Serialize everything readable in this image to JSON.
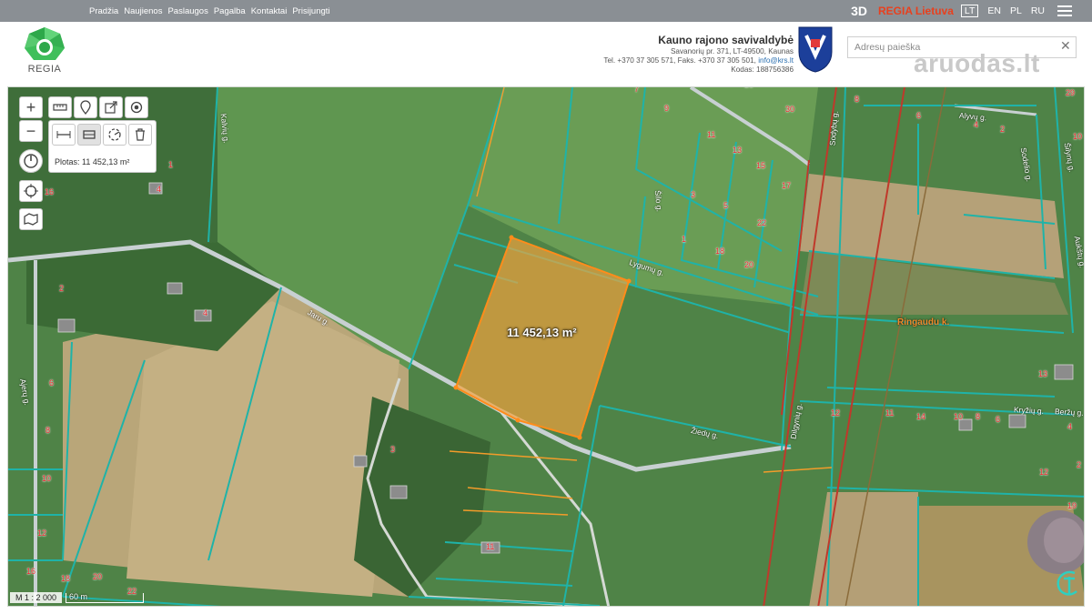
{
  "topnav": {
    "items": [
      "Pradžia",
      "Naujienos",
      "Paslaugos",
      "Pagalba",
      "Kontaktai",
      "Prisijungti"
    ],
    "mode_3d": "3D",
    "regia_label": "REGIA Lietuva",
    "languages": [
      "LT",
      "EN",
      "PL",
      "RU"
    ],
    "active_language": "LT"
  },
  "header": {
    "logo_text": "REGIA",
    "municipality": {
      "name": "Kauno rajono savivaldybė",
      "address": "Savanorių pr. 371, LT-49500, Kaunas",
      "phone_fax": "Tel. +370 37 305 571, Faks. +370 37 305 501,",
      "email": "info@krs.lt",
      "code": "Kodas: 188756386"
    },
    "search_placeholder": "Adresų paieška",
    "search_value": "",
    "watermark": "aruodas.lt"
  },
  "map": {
    "area_readout": "Plotas: 11 452,13 m²",
    "area_label": "11 452,13 m²",
    "scale_ratio": "M 1 : 2 000",
    "scale_distance": "60 m",
    "street_labels": [
      "Kalvių g.",
      "Jaru g.",
      "Lygumų g.",
      "Žiedų g.",
      "Ajerų g.",
      "Šilo g.",
      "Sodybų g.",
      "Alyvų g.",
      "Sodelio g.",
      "Dilgynių g.",
      "Kryžių g.",
      "Beržų g.",
      "Šilynų g.",
      "Aukštų g."
    ],
    "village_label": "Ringaudu k.",
    "plot_numbers": [
      "7",
      "9",
      "11",
      "13",
      "15",
      "17",
      "3",
      "5",
      "22",
      "1",
      "18",
      "20",
      "30",
      "28",
      "8",
      "6",
      "4",
      "2",
      "29",
      "10",
      "1",
      "4",
      "2",
      "6",
      "8",
      "10",
      "12",
      "16",
      "18",
      "20",
      "22",
      "3",
      "11",
      "13",
      "12",
      "11",
      "14",
      "10",
      "8",
      "6",
      "12",
      "4",
      "2",
      "19",
      "16",
      "4"
    ],
    "colors": {
      "parcel_border": "#1fb3a8",
      "selection_fill": "#f5a23c",
      "selection_border": "#ff8c1a",
      "power_line": "#c0392b",
      "road": "#c8d0d2",
      "plot_number": "#e8262b"
    },
    "controls": [
      "zoom-in",
      "zoom-out",
      "compass",
      "locate",
      "layers",
      "measure-distance",
      "add-marker",
      "share",
      "target",
      "measure-line",
      "measure-area",
      "measure-radius",
      "delete-measurement"
    ]
  }
}
